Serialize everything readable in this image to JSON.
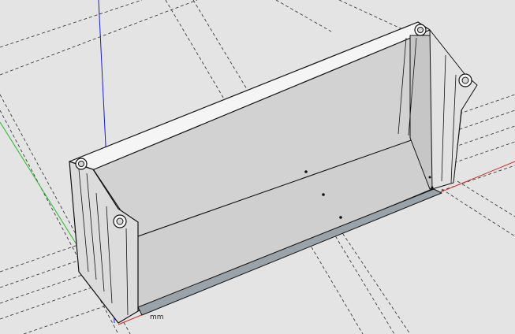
{
  "viewport": {
    "background_color": "#e4e4e4",
    "axis_colors": {
      "blue_axis": "#1a1ad6",
      "green_axis": "#2eb82e",
      "red_axis": "#d22a2a"
    },
    "model_colors": {
      "face_light": "#f7f7f7",
      "face_mid": "#d8d8d8",
      "face_dark": "#bdbdbd",
      "edge": "#111111",
      "guide": "#222222"
    },
    "dimension_text": "mm"
  }
}
